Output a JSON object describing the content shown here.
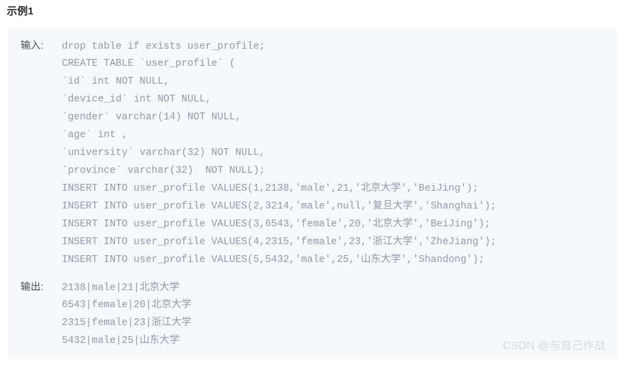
{
  "heading": {
    "title": "示例1"
  },
  "code_block": {
    "background_color": "#f7f8fa",
    "code_color": "#9099ad",
    "label_color": "#4a4f57",
    "input": {
      "label": "输入:",
      "lines": [
        "drop table if exists user_profile;",
        "CREATE TABLE `user_profile` (",
        "`id` int NOT NULL,",
        "`device_id` int NOT NULL,",
        "`gender` varchar(14) NOT NULL,",
        "`age` int ,",
        "`university` varchar(32) NOT NULL,",
        "`province` varchar(32)  NOT NULL);",
        "INSERT INTO user_profile VALUES(1,2138,'male',21,'北京大学','BeiJing');",
        "INSERT INTO user_profile VALUES(2,3214,'male',null,'复旦大学','Shanghai');",
        "INSERT INTO user_profile VALUES(3,6543,'female',20,'北京大学','BeiJing');",
        "INSERT INTO user_profile VALUES(4,2315,'female',23,'浙江大学','ZheJiang');",
        "INSERT INTO user_profile VALUES(5,5432,'male',25,'山东大学','Shandong');"
      ]
    },
    "output": {
      "label": "输出:",
      "lines": [
        "2138|male|21|北京大学",
        "6543|female|20|北京大学",
        "2315|female|23|浙江大学",
        "5432|male|25|山东大学"
      ]
    }
  },
  "watermark": {
    "text": "CSDN @与自己作战"
  }
}
